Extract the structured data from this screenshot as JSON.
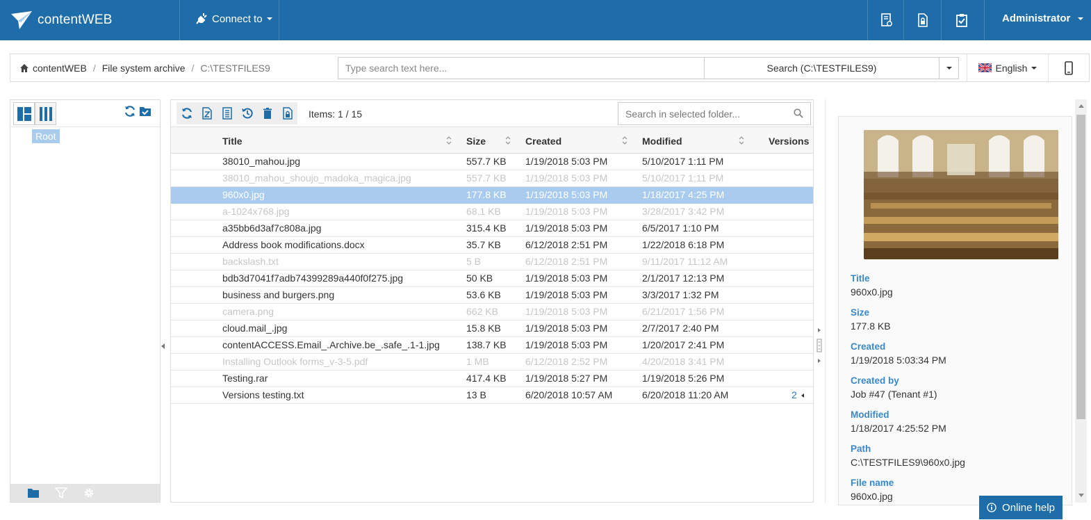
{
  "app": {
    "brand": "contentWEB",
    "connect_label": "Connect to",
    "user": "Administrator"
  },
  "breadcrumb": {
    "items": [
      "contentWEB",
      "File system archive"
    ],
    "current": "C:\\TESTFILES9"
  },
  "search": {
    "placeholder": "Type search text here...",
    "button_label": "Search (C:\\TESTFILES9)"
  },
  "language": {
    "label": "English"
  },
  "tree": {
    "root_label": "Root"
  },
  "list": {
    "items_count": "Items: 1 / 15",
    "folder_search_placeholder": "Search in selected folder...",
    "columns": {
      "title": "Title",
      "size": "Size",
      "created": "Created",
      "modified": "Modified",
      "versions": "Versions"
    },
    "rows": [
      {
        "title": "38010_mahou.jpg",
        "size": "557.7 KB",
        "created": "1/19/2018 5:03 PM",
        "modified": "5/10/2017 1:11 PM",
        "versions": "",
        "state": "normal"
      },
      {
        "title": "38010_mahou_shoujo_madoka_magica.jpg",
        "size": "557.7 KB",
        "created": "1/19/2018 5:03 PM",
        "modified": "5/10/2017 1:11 PM",
        "versions": "",
        "state": "dim"
      },
      {
        "title": "960x0.jpg",
        "size": "177.8 KB",
        "created": "1/19/2018 5:03 PM",
        "modified": "1/18/2017 4:25 PM",
        "versions": "",
        "state": "selected"
      },
      {
        "title": "a-1024x768.jpg",
        "size": "68.1 KB",
        "created": "1/19/2018 5:03 PM",
        "modified": "3/28/2017 3:42 PM",
        "versions": "",
        "state": "dim"
      },
      {
        "title": "a35bb6d3af7c808a.jpg",
        "size": "315.4 KB",
        "created": "1/19/2018 5:03 PM",
        "modified": "6/5/2017 1:10 PM",
        "versions": "",
        "state": "normal"
      },
      {
        "title": "Address book modifications.docx",
        "size": "35.7 KB",
        "created": "6/12/2018 2:51 PM",
        "modified": "1/22/2018 6:18 PM",
        "versions": "",
        "state": "normal"
      },
      {
        "title": "backslash.txt",
        "size": "5 B",
        "created": "6/12/2018 2:51 PM",
        "modified": "9/11/2017 11:12 AM",
        "versions": "",
        "state": "dim"
      },
      {
        "title": "bdb3d7041f7adb74399289a440f0f275.jpg",
        "size": "50 KB",
        "created": "1/19/2018 5:03 PM",
        "modified": "2/1/2017 12:13 PM",
        "versions": "",
        "state": "normal"
      },
      {
        "title": "business and burgers.png",
        "size": "53.6 KB",
        "created": "1/19/2018 5:03 PM",
        "modified": "3/3/2017 1:32 PM",
        "versions": "",
        "state": "normal"
      },
      {
        "title": "camera.png",
        "size": "662 KB",
        "created": "1/19/2018 5:03 PM",
        "modified": "6/21/2017 1:56 PM",
        "versions": "",
        "state": "dim"
      },
      {
        "title": "cloud.mail_.jpg",
        "size": "15.8 KB",
        "created": "1/19/2018 5:03 PM",
        "modified": "2/7/2017 2:40 PM",
        "versions": "",
        "state": "normal"
      },
      {
        "title": "contentACCESS.Email_.Archive.be_.safe_.1-1.jpg",
        "size": "138.7 KB",
        "created": "1/19/2018 5:03 PM",
        "modified": "1/20/2017 2:41 PM",
        "versions": "",
        "state": "normal"
      },
      {
        "title": "Installing Outlook forms_v-3-5.pdf",
        "size": "1 MB",
        "created": "6/12/2018 2:52 PM",
        "modified": "4/20/2018 3:41 PM",
        "versions": "",
        "state": "dim"
      },
      {
        "title": "Testing.rar",
        "size": "417.4 KB",
        "created": "1/19/2018 5:27 PM",
        "modified": "1/19/2018 5:26 PM",
        "versions": "",
        "state": "normal"
      },
      {
        "title": "Versions testing.txt",
        "size": "13 B",
        "created": "6/20/2018 10:57 AM",
        "modified": "6/20/2018 11:20 AM",
        "versions": "2",
        "state": "normal"
      }
    ]
  },
  "details": {
    "props": [
      {
        "label": "Title",
        "value": "960x0.jpg"
      },
      {
        "label": "Size",
        "value": "177.8 KB"
      },
      {
        "label": "Created",
        "value": "1/19/2018 5:03:34 PM"
      },
      {
        "label": "Created by",
        "value": "Job #47 (Tenant #1)"
      },
      {
        "label": "Modified",
        "value": "1/18/2017 4:25:52 PM"
      },
      {
        "label": "Path",
        "value": "C:\\TESTFILES9\\960x0.jpg"
      },
      {
        "label": "File name",
        "value": "960x0.jpg"
      }
    ]
  },
  "help": {
    "label": "Online help"
  },
  "colors": {
    "primary": "#1f6da8",
    "selected_row": "#a9ccee",
    "accent_label": "#3a88c8",
    "dim_text": "#c6c6c6"
  },
  "icons": [
    "logo-icon",
    "plug-icon",
    "report-icon",
    "document-lock-icon",
    "clipboard-check-icon",
    "home-icon",
    "uk-flag-icon",
    "mobile-icon",
    "tree-view-icon",
    "columns-view-icon",
    "refresh-icon",
    "folder-check-icon",
    "zip-icon",
    "list-icon",
    "history-icon",
    "trash-icon",
    "lock-file-icon",
    "search-icon",
    "folder-icon",
    "filter-icon",
    "gear-icon",
    "info-icon"
  ]
}
